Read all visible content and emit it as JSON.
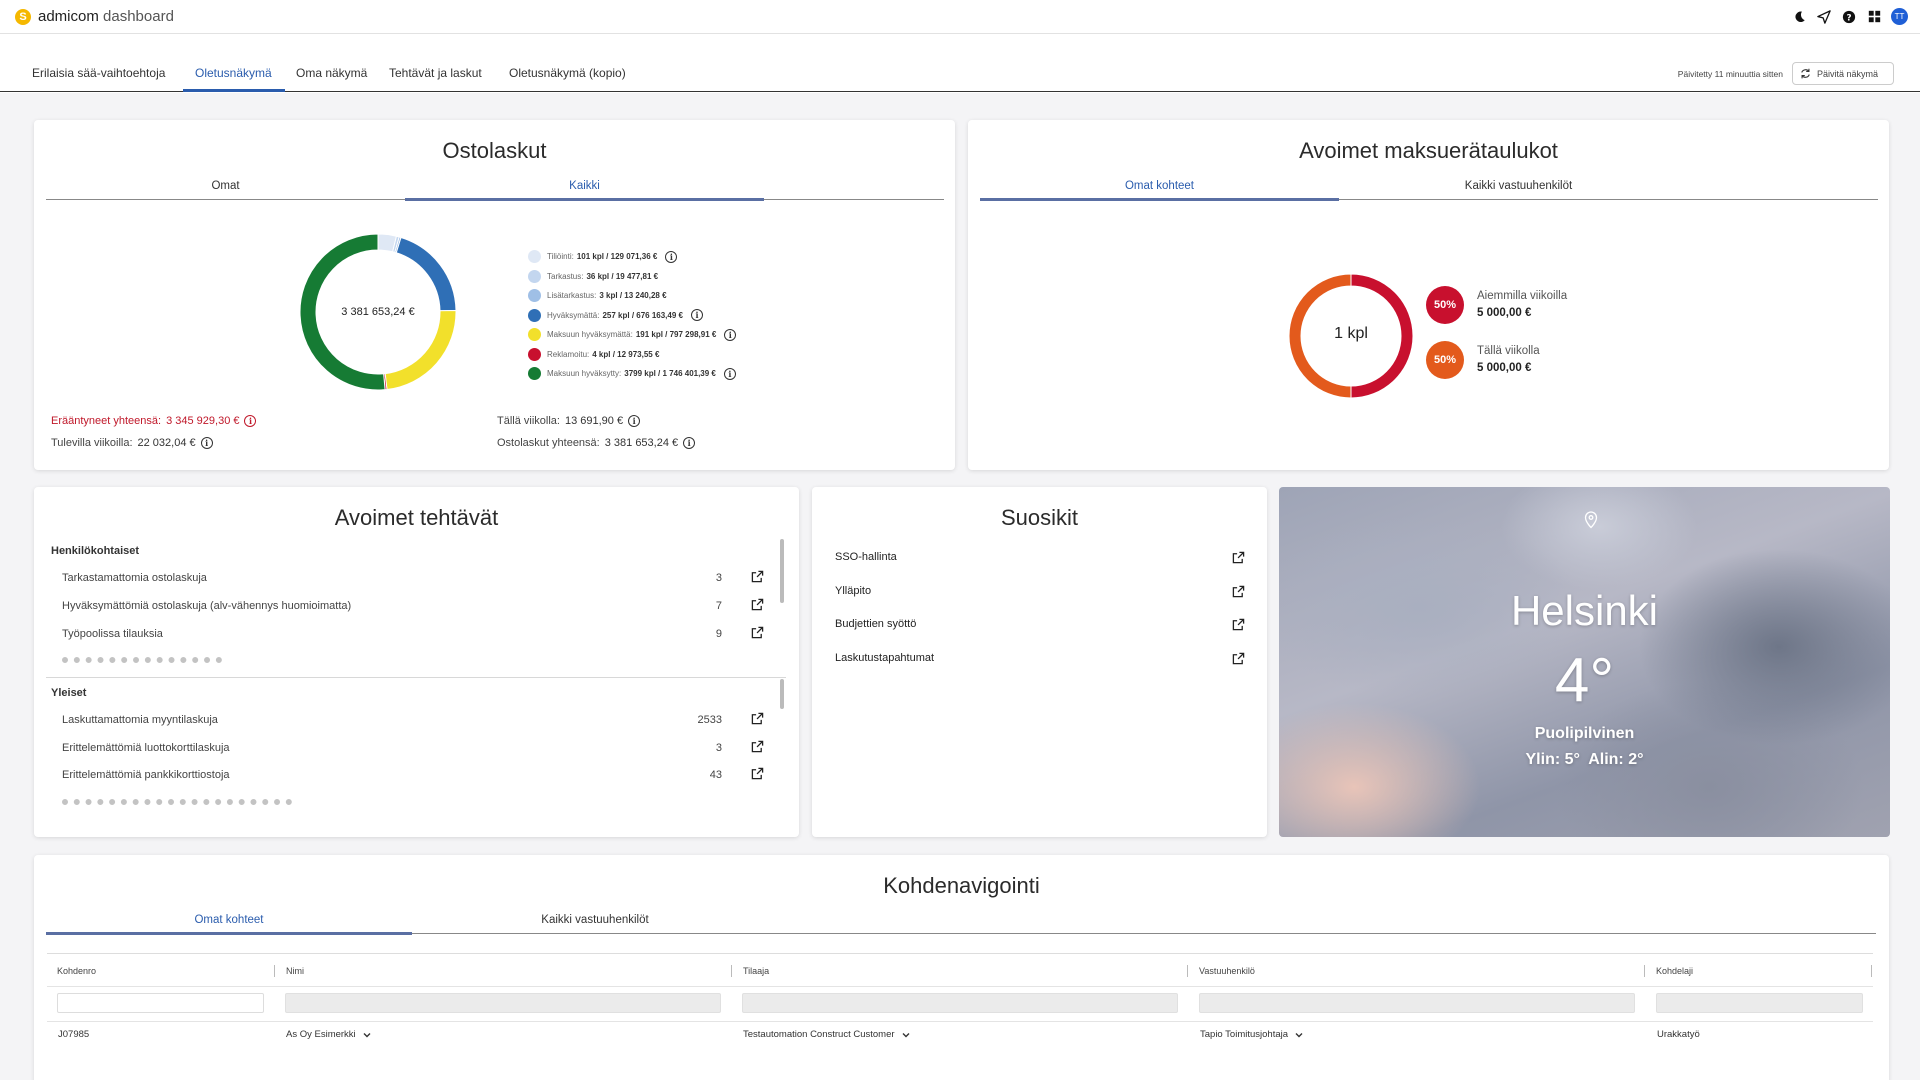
{
  "app": {
    "brand_bold": "admicom",
    "brand_thin": " dashboard",
    "logo_letter": "S"
  },
  "header_icons": [
    "moon-icon",
    "send-icon",
    "help-icon",
    "apps-grid-icon"
  ],
  "avatar_initials": "TT",
  "tabs": [
    {
      "label": "Erilaisia sää-vaihtoehtoja"
    },
    {
      "label": "Oletusnäkymä",
      "active": true
    },
    {
      "label": "Oma näkymä"
    },
    {
      "label": "Tehtävät ja laskut"
    },
    {
      "label": "Oletusnäkymä (kopio)"
    }
  ],
  "updated_text": "Päivitetty 11 minuuttia sitten",
  "refresh_label": "Päivitä näkymä",
  "ostolaskut": {
    "title": "Ostolaskut",
    "tabs": [
      "Omat",
      "Kaikki"
    ],
    "active_tab": "Kaikki",
    "center_total": "3 381 653,24 €",
    "legend": [
      {
        "label": "Tiliöinti:",
        "value": "101 kpl / 129 071,36 €",
        "color": "#dfe8f5",
        "info": true
      },
      {
        "label": "Tarkastus:",
        "value": "36 kpl / 19 477,81 €",
        "color": "#c3d6ef",
        "info": false
      },
      {
        "label": "Lisätarkastus:",
        "value": "3 kpl / 13 240,28 €",
        "color": "#9fbfe6",
        "info": false
      },
      {
        "label": "Hyväksymättä:",
        "value": "257 kpl / 676 163,49 €",
        "color": "#2f6fb6",
        "info": true
      },
      {
        "label": "Maksuun hyväksymättä:",
        "value": "191 kpl / 797 298,91 €",
        "color": "#f2e02b",
        "info": true
      },
      {
        "label": "Reklamoitu:",
        "value": "4 kpl / 12 973,55 €",
        "color": "#c8102e",
        "info": false
      },
      {
        "label": "Maksuun hyväksytty:",
        "value": "3799 kpl / 1 746 401,39 €",
        "color": "#167b34",
        "info": true
      }
    ],
    "chart_data": {
      "type": "pie",
      "title": "Ostolaskut",
      "categories": [
        "Tiliöinti",
        "Tarkastus",
        "Lisätarkastus",
        "Hyväksymättä",
        "Maksuun hyväksymättä",
        "Reklamoitu",
        "Maksuun hyväksytty"
      ],
      "values": [
        129071.36,
        19477.81,
        13240.28,
        676163.49,
        797298.91,
        12973.55,
        1746401.39
      ],
      "colors": [
        "#dfe8f5",
        "#c3d6ef",
        "#9fbfe6",
        "#2f6fb6",
        "#f2e02b",
        "#c8102e",
        "#167b34"
      ]
    },
    "overdue_label": "Erääntyneet yhteensä:",
    "overdue_value": "3 345 929,30 €",
    "upcoming_label": "Tulevilla viikoilla:",
    "upcoming_value": "22 032,04 €",
    "thisweek_label": "Tällä viikolla:",
    "thisweek_value": "13 691,90 €",
    "total_label": "Ostolaskut yhteensä:",
    "total_value": "3 381 653,24 €"
  },
  "maksuerat": {
    "title": "Avoimet maksuerätaulukot",
    "tabs": [
      "Omat kohteet",
      "Kaikki vastuuhenkilöt"
    ],
    "active_tab": "Omat kohteet",
    "center_label": "1 kpl",
    "items": [
      {
        "badge": "50%",
        "label": "Aiemmilla viikoilla",
        "value": "5 000,00 €",
        "color": "#c8102e"
      },
      {
        "badge": "50%",
        "label": "Tällä viikolla",
        "value": "5 000,00 €",
        "color": "#e35a1c"
      }
    ],
    "chart_data": {
      "type": "pie",
      "categories": [
        "Aiemmilla viikoilla",
        "Tällä viikolla"
      ],
      "values": [
        5000.0,
        5000.0
      ],
      "colors": [
        "#c8102e",
        "#e35a1c"
      ]
    }
  },
  "tehtavat": {
    "title": "Avoimet tehtävät",
    "personal_label": "Henkilökohtaiset",
    "personal": [
      {
        "label": "Tarkastamattomia ostolaskuja",
        "count": "3"
      },
      {
        "label": "Hyväksymättömiä ostolaskuja (alv-vähennys huomioimatta)",
        "count": "7"
      },
      {
        "label": "Työpoolissa tilauksia",
        "count": "9"
      }
    ],
    "general_label": "Yleiset",
    "general": [
      {
        "label": "Laskuttamattomia myyntilaskuja",
        "count": "2533"
      },
      {
        "label": "Erittelemättömiä luottokorttilaskuja",
        "count": "3"
      },
      {
        "label": "Erittelemättömiä pankkikorttiostoja",
        "count": "43"
      }
    ]
  },
  "suosikit": {
    "title": "Suosikit",
    "items": [
      "SSO-hallinta",
      "Ylläpito",
      "Budjettien syöttö",
      "Laskutustapahtumat"
    ]
  },
  "weather": {
    "city": "Helsinki",
    "temp": "4°",
    "condition": "Puolipilvinen",
    "hilo": "Ylin: 5°  Alin: 2°"
  },
  "kohdenavigointi": {
    "title": "Kohdenavigointi",
    "tabs": [
      "Omat kohteet",
      "Kaikki vastuuhenkilöt"
    ],
    "active_tab": "Omat kohteet",
    "columns": [
      "Kohdenro",
      "Nimi",
      "Tilaaja",
      "Vastuuhenkilö",
      "Kohdelaji"
    ],
    "rows": [
      {
        "kohdenro": "J07985",
        "nimi": "As Oy Esimerkki",
        "tilaaja": "Testautomation Construct Customer",
        "vastuuhenkilo": "Tapio Toimitusjohtaja",
        "kohdelaji": "Urakkatyö"
      }
    ]
  }
}
